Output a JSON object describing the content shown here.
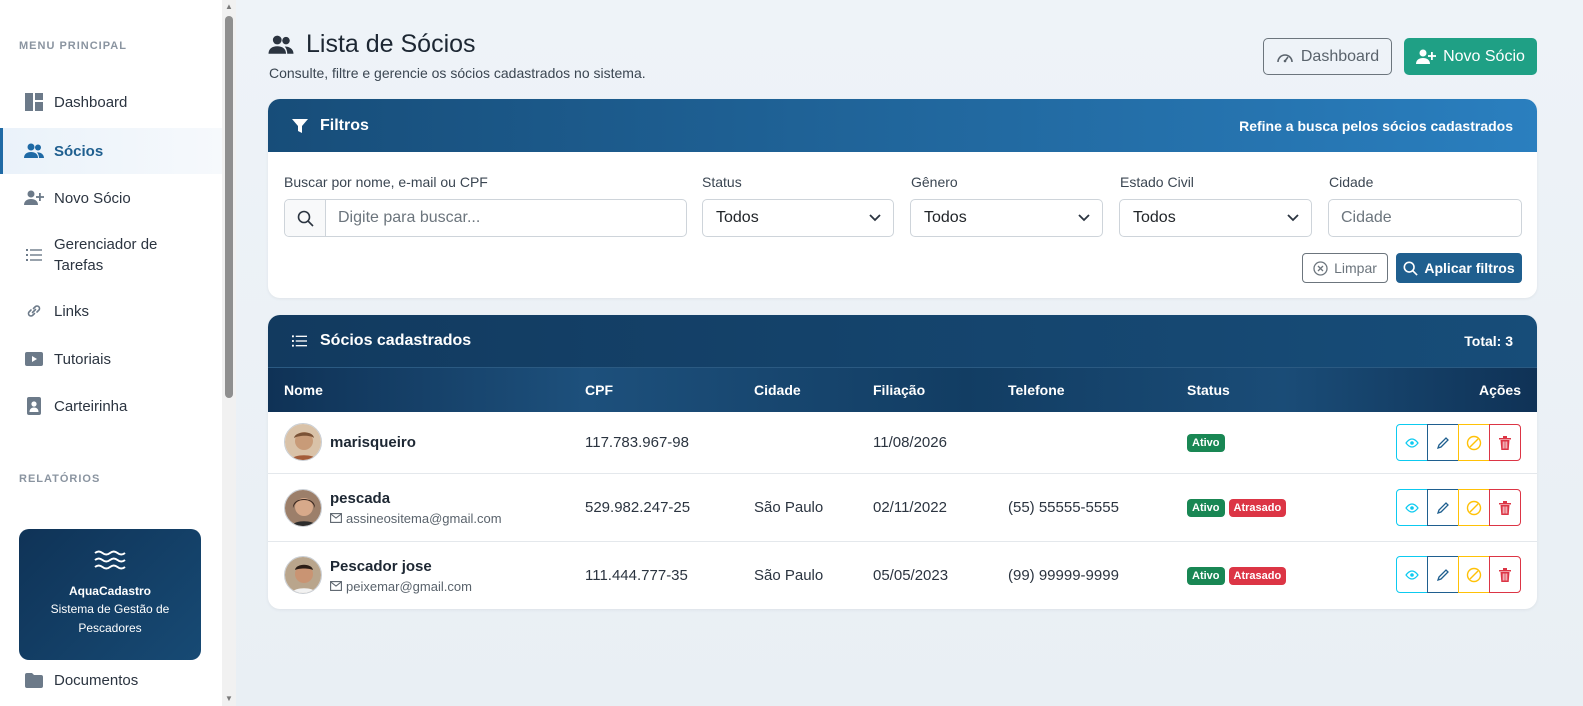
{
  "sidebar": {
    "section_main": "MENU PRINCIPAL",
    "section_reports": "RELATÓRIOS",
    "items": [
      {
        "label": "Dashboard",
        "icon": "dashboard-icon"
      },
      {
        "label": "Sócios",
        "icon": "users-icon"
      },
      {
        "label": "Novo Sócio",
        "icon": "user-plus-icon"
      },
      {
        "label": "Gerenciador de Tarefas",
        "icon": "list-icon"
      },
      {
        "label": "Links",
        "icon": "link-icon"
      },
      {
        "label": "Tutoriais",
        "icon": "play-icon"
      },
      {
        "label": "Carteirinha",
        "icon": "id-card-icon"
      }
    ],
    "bottom_item": {
      "label": "Documentos",
      "icon": "folder-icon"
    },
    "brand": {
      "title": "AquaCadastro",
      "subtitle": "Sistema de Gestão de Pescadores",
      "icon": "waves-icon"
    }
  },
  "header": {
    "title": "Lista de Sócios",
    "subtitle": "Consulte, filtre e gerencie os sócios cadastrados no sistema.",
    "dashboard_button": "Dashboard",
    "new_button": "Novo Sócio"
  },
  "filters": {
    "title": "Filtros",
    "hint": "Refine a busca pelos sócios cadastrados",
    "search_label": "Buscar por nome, e-mail ou CPF",
    "search_placeholder": "Digite para buscar...",
    "status_label": "Status",
    "status_value": "Todos",
    "gender_label": "Gênero",
    "gender_value": "Todos",
    "marital_label": "Estado Civil",
    "marital_value": "Todos",
    "city_label": "Cidade",
    "city_placeholder": "Cidade",
    "clear_button": "Limpar",
    "apply_button": "Aplicar filtros"
  },
  "table": {
    "title": "Sócios cadastrados",
    "total": "Total: 3",
    "columns": [
      "Nome",
      "CPF",
      "Cidade",
      "Filiação",
      "Telefone",
      "Status",
      "Ações"
    ],
    "rows": [
      {
        "name": "marisqueiro",
        "email": "",
        "cpf": "117.783.967-98",
        "city": "",
        "affiliation": "11/08/2026",
        "phone": "",
        "badges": [
          "Ativo"
        ]
      },
      {
        "name": "pescada",
        "email": "assineositema@gmail.com",
        "cpf": "529.982.247-25",
        "city": "São Paulo",
        "affiliation": "02/11/2022",
        "phone": "(55) 55555-5555",
        "badges": [
          "Ativo",
          "Atrasado"
        ]
      },
      {
        "name": "Pescador jose",
        "email": "peixemar@gmail.com",
        "cpf": "111.444.777-35",
        "city": "São Paulo",
        "affiliation": "05/05/2023",
        "phone": "(99) 99999-9999",
        "badges": [
          "Ativo",
          "Atrasado"
        ]
      }
    ]
  },
  "colors": {
    "primary": "#1f5f8f",
    "success": "#1fa085",
    "badge_active": "#198754",
    "badge_late": "#dc3545"
  }
}
